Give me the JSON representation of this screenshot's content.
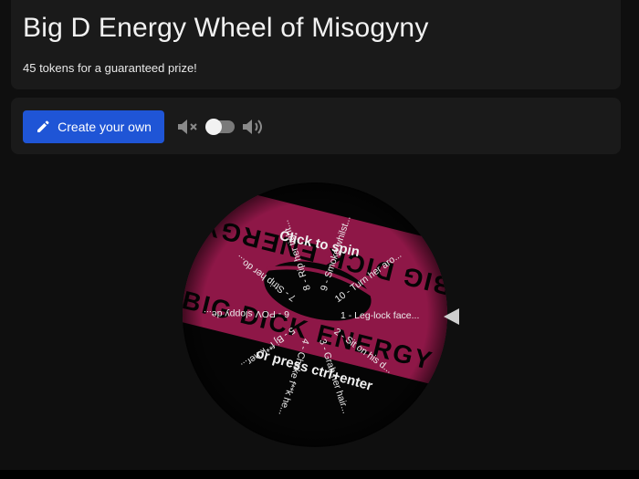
{
  "header": {
    "title": "Big D Energy Wheel of Misogyny",
    "subtitle": "45 tokens for a guaranteed prize!"
  },
  "controls": {
    "create_label": "Create your own",
    "sound_toggle_on": false
  },
  "wheel": {
    "center_top": "Click to spin",
    "center_bottom": "or press ctrl+enter",
    "banner_text": "BIG DICK ENERGY",
    "segments": [
      "1 - Leg-lock face...",
      "2 - Sit on his d...",
      "3 - Grab her hair...",
      "4 - Choke f**k he...",
      "5 - Bj f**k her...",
      "6 - POV sloppy de...",
      "7 - Strip her do...",
      "8 - Rip her tight...",
      "9 - Smoke whilst...",
      "10 - Turn her aro..."
    ],
    "colors": {
      "banner": "#8e1747",
      "wheel_bg": "#050505",
      "text": "#ececec",
      "pointer": "#cfcfcf"
    }
  }
}
